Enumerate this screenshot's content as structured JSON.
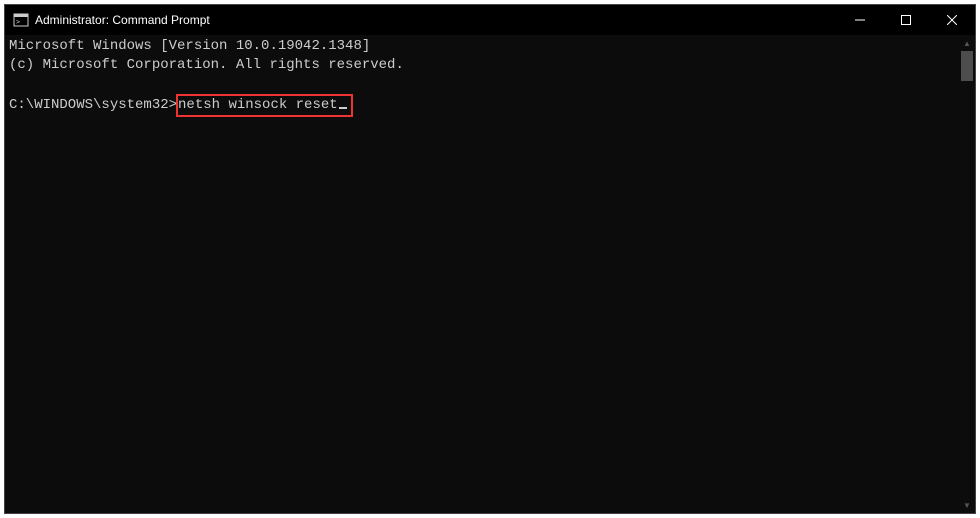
{
  "window": {
    "title": "Administrator: Command Prompt"
  },
  "terminal": {
    "line1": "Microsoft Windows [Version 10.0.19042.1348]",
    "line2": "(c) Microsoft Corporation. All rights reserved.",
    "prompt": "C:\\WINDOWS\\system32>",
    "command": "netsh winsock reset"
  }
}
